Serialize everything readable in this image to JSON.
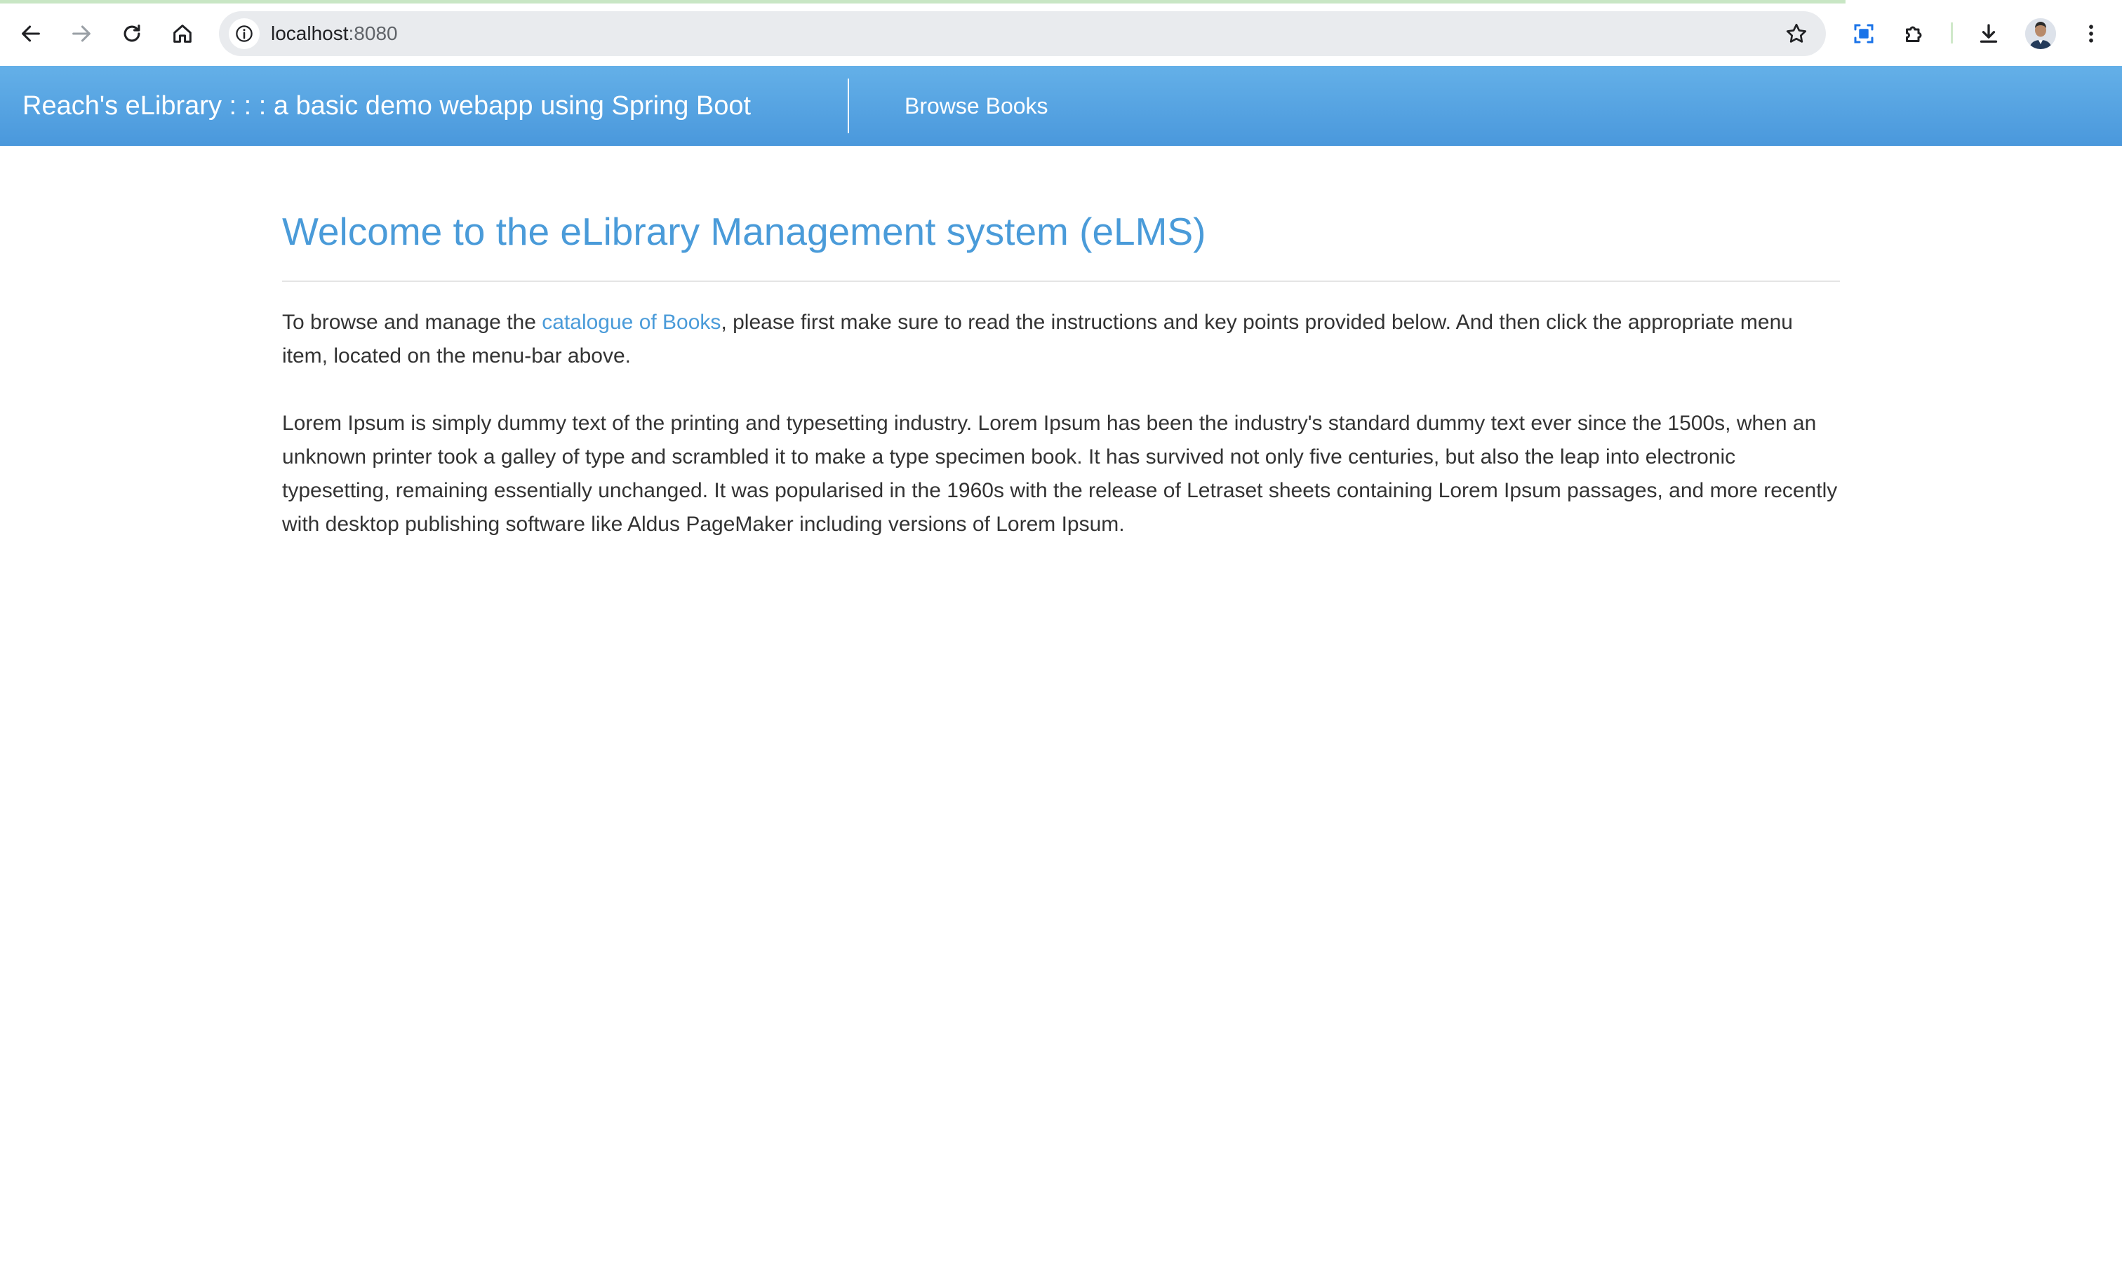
{
  "browser": {
    "url_host": "localhost",
    "url_port": ":8080",
    "icons": {
      "back": "arrow-left-icon",
      "forward": "arrow-right-icon",
      "reload": "reload-icon",
      "home": "home-icon",
      "site_info": "info-icon",
      "bookmark": "star-icon",
      "screen_capture": "screen-capture-icon",
      "extensions": "puzzle-icon",
      "downloads": "download-icon",
      "menu": "kebab-menu-icon"
    }
  },
  "navbar": {
    "brand": "Reach's eLibrary : : : a basic demo webapp using Spring Boot",
    "links": [
      "Browse Books"
    ],
    "gradient_top": "#64b0e8",
    "gradient_bottom": "#4a98dc"
  },
  "content": {
    "title": "Welcome to the eLibrary Management system (eLMS)",
    "intro": {
      "before_link": "To browse and manage the ",
      "link_text": "catalogue of Books",
      "after_link": ", please first make sure to read the instructions and key points provided below. And then click the appropriate menu item, located on the menu-bar above."
    },
    "lorem": "Lorem Ipsum is simply dummy text of the printing and typesetting industry. Lorem Ipsum has been the industry's standard dummy text ever since the 1500s, when an unknown printer took a galley of type and scrambled it to make a type specimen book. It has survived not only five centuries, but also the leap into electronic typesetting, remaining essentially unchanged. It was popularised in the 1960s with the release of Letraset sheets containing Lorem Ipsum passages, and more recently with desktop publishing software like Aldus PageMaker including versions of Lorem Ipsum."
  },
  "colors": {
    "accent": "#4a9bd9",
    "text": "#333333"
  }
}
